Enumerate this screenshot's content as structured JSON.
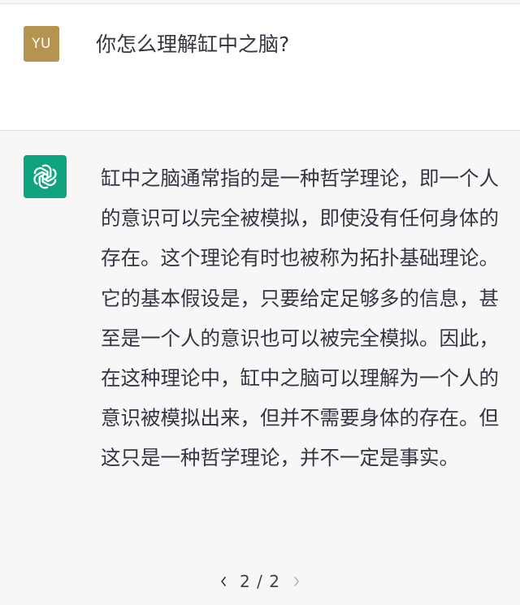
{
  "conversation": {
    "user_message": {
      "avatar_text": "YU",
      "avatar_color": "#b6944f",
      "text": "你怎么理解缸中之脑?"
    },
    "assistant_message": {
      "avatar_icon": "openai-logo-icon",
      "avatar_color": "#10a37f",
      "text": "缸中之脑通常指的是一种哲学理论，即一个人的意识可以完全被模拟，即使没有任何身体的存在。这个理论有时也被称为拓扑基础理论。它的基本假设是，只要给定足够多的信息，甚至是一个人的意识也可以被完全模拟。因此，在这种理论中，缸中之脑可以理解为一个人的意识被模拟出来，但并不需要身体的存在。但这只是一种哲学理论，并不一定是事实。"
    },
    "pager": {
      "prev_icon": "chevron-left-icon",
      "next_icon": "chevron-right-icon",
      "label": "2 / 2"
    }
  }
}
